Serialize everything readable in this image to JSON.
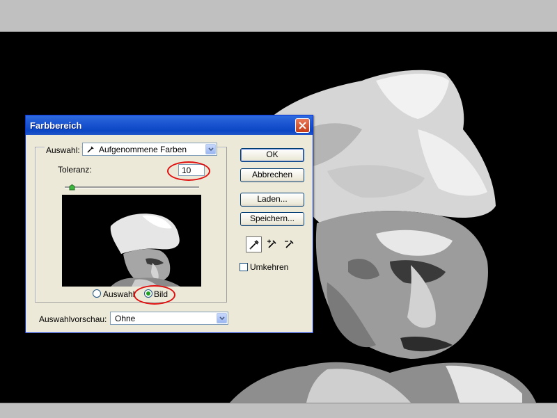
{
  "dialog": {
    "title": "Farbbereich",
    "select_label": "Auswahl:",
    "select_value": "Aufgenommene Farben",
    "tolerance_label": "Toleranz:",
    "tolerance_value": "10",
    "tolerance_slider_fraction": 0.05,
    "radio_selection_label": "Auswahl",
    "radio_image_label": "Bild",
    "radio_selected": "Bild",
    "preview_label": "Auswahlvorschau:",
    "preview_value": "Ohne",
    "buttons": {
      "ok": "OK",
      "cancel": "Abbrechen",
      "load": "Laden...",
      "save": "Speichern..."
    },
    "invert_label": "Umkehren",
    "invert_checked": false
  },
  "colors": {
    "titlebar": "#0a46c4",
    "dialog_bg": "#ece9d8",
    "highlight_red": "#e01010"
  },
  "icons": [
    "eyedropper-icon",
    "eyedropper-plus-icon",
    "eyedropper-minus-icon",
    "close-icon",
    "chevron-down-icon"
  ]
}
